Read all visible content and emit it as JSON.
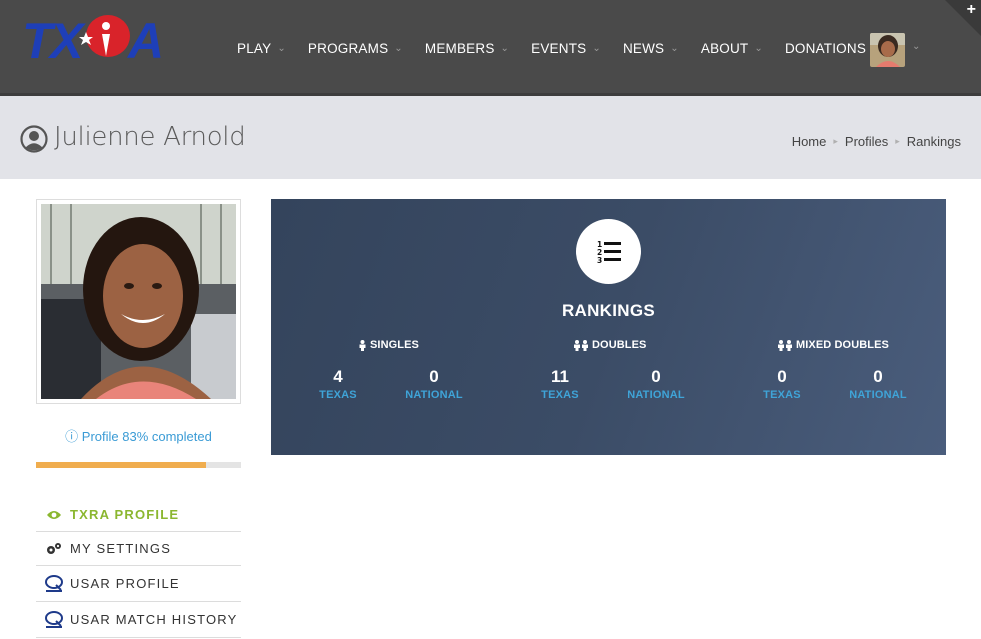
{
  "header": {
    "logo_text": "TXRA",
    "nav": [
      {
        "label": "PLAY",
        "has_dropdown": true
      },
      {
        "label": "PROGRAMS",
        "has_dropdown": true
      },
      {
        "label": "MEMBERS",
        "has_dropdown": true
      },
      {
        "label": "EVENTS",
        "has_dropdown": true
      },
      {
        "label": "NEWS",
        "has_dropdown": true
      },
      {
        "label": "ABOUT",
        "has_dropdown": true
      },
      {
        "label": "DONATIONS",
        "has_dropdown": false
      }
    ],
    "corner_icon": "plus-icon"
  },
  "page": {
    "title": "Julienne Arnold",
    "title_icon": "user-circle-icon",
    "breadcrumb": [
      "Home",
      "Profiles",
      "Rankings"
    ]
  },
  "sidebar": {
    "profile_complete_text": "Profile 83% completed",
    "profile_complete_fraction": 0.83,
    "menu": [
      {
        "label": "TXRA PROFILE",
        "icon": "eye-icon",
        "active": true
      },
      {
        "label": "MY SETTINGS",
        "icon": "gears-icon",
        "active": false
      },
      {
        "label": "USAR PROFILE",
        "icon": "usar-logo-icon",
        "active": false
      },
      {
        "label": "USAR MATCH HISTORY",
        "icon": "usar-logo-icon",
        "active": false
      }
    ]
  },
  "rankings": {
    "title": "RANKINGS",
    "icon": "ordered-list-icon",
    "categories": [
      {
        "label": "SINGLES",
        "icon": "single-person-icon",
        "texas": "4",
        "national": "0"
      },
      {
        "label": "DOUBLES",
        "icon": "two-person-icon",
        "texas": "11",
        "national": "0"
      },
      {
        "label": "MIXED DOUBLES",
        "icon": "two-person-icon",
        "texas": "0",
        "national": "0"
      }
    ],
    "texas_label": "TEXAS",
    "national_label": "NATIONAL"
  },
  "colors": {
    "header_bg": "#4a4a4a",
    "titlebar_bg": "#e2e3e8",
    "accent_green": "#8bb730",
    "link_blue": "#3a9bd5",
    "progress_orange": "#f0ad4e",
    "panel_bg": "#3b4c66"
  }
}
